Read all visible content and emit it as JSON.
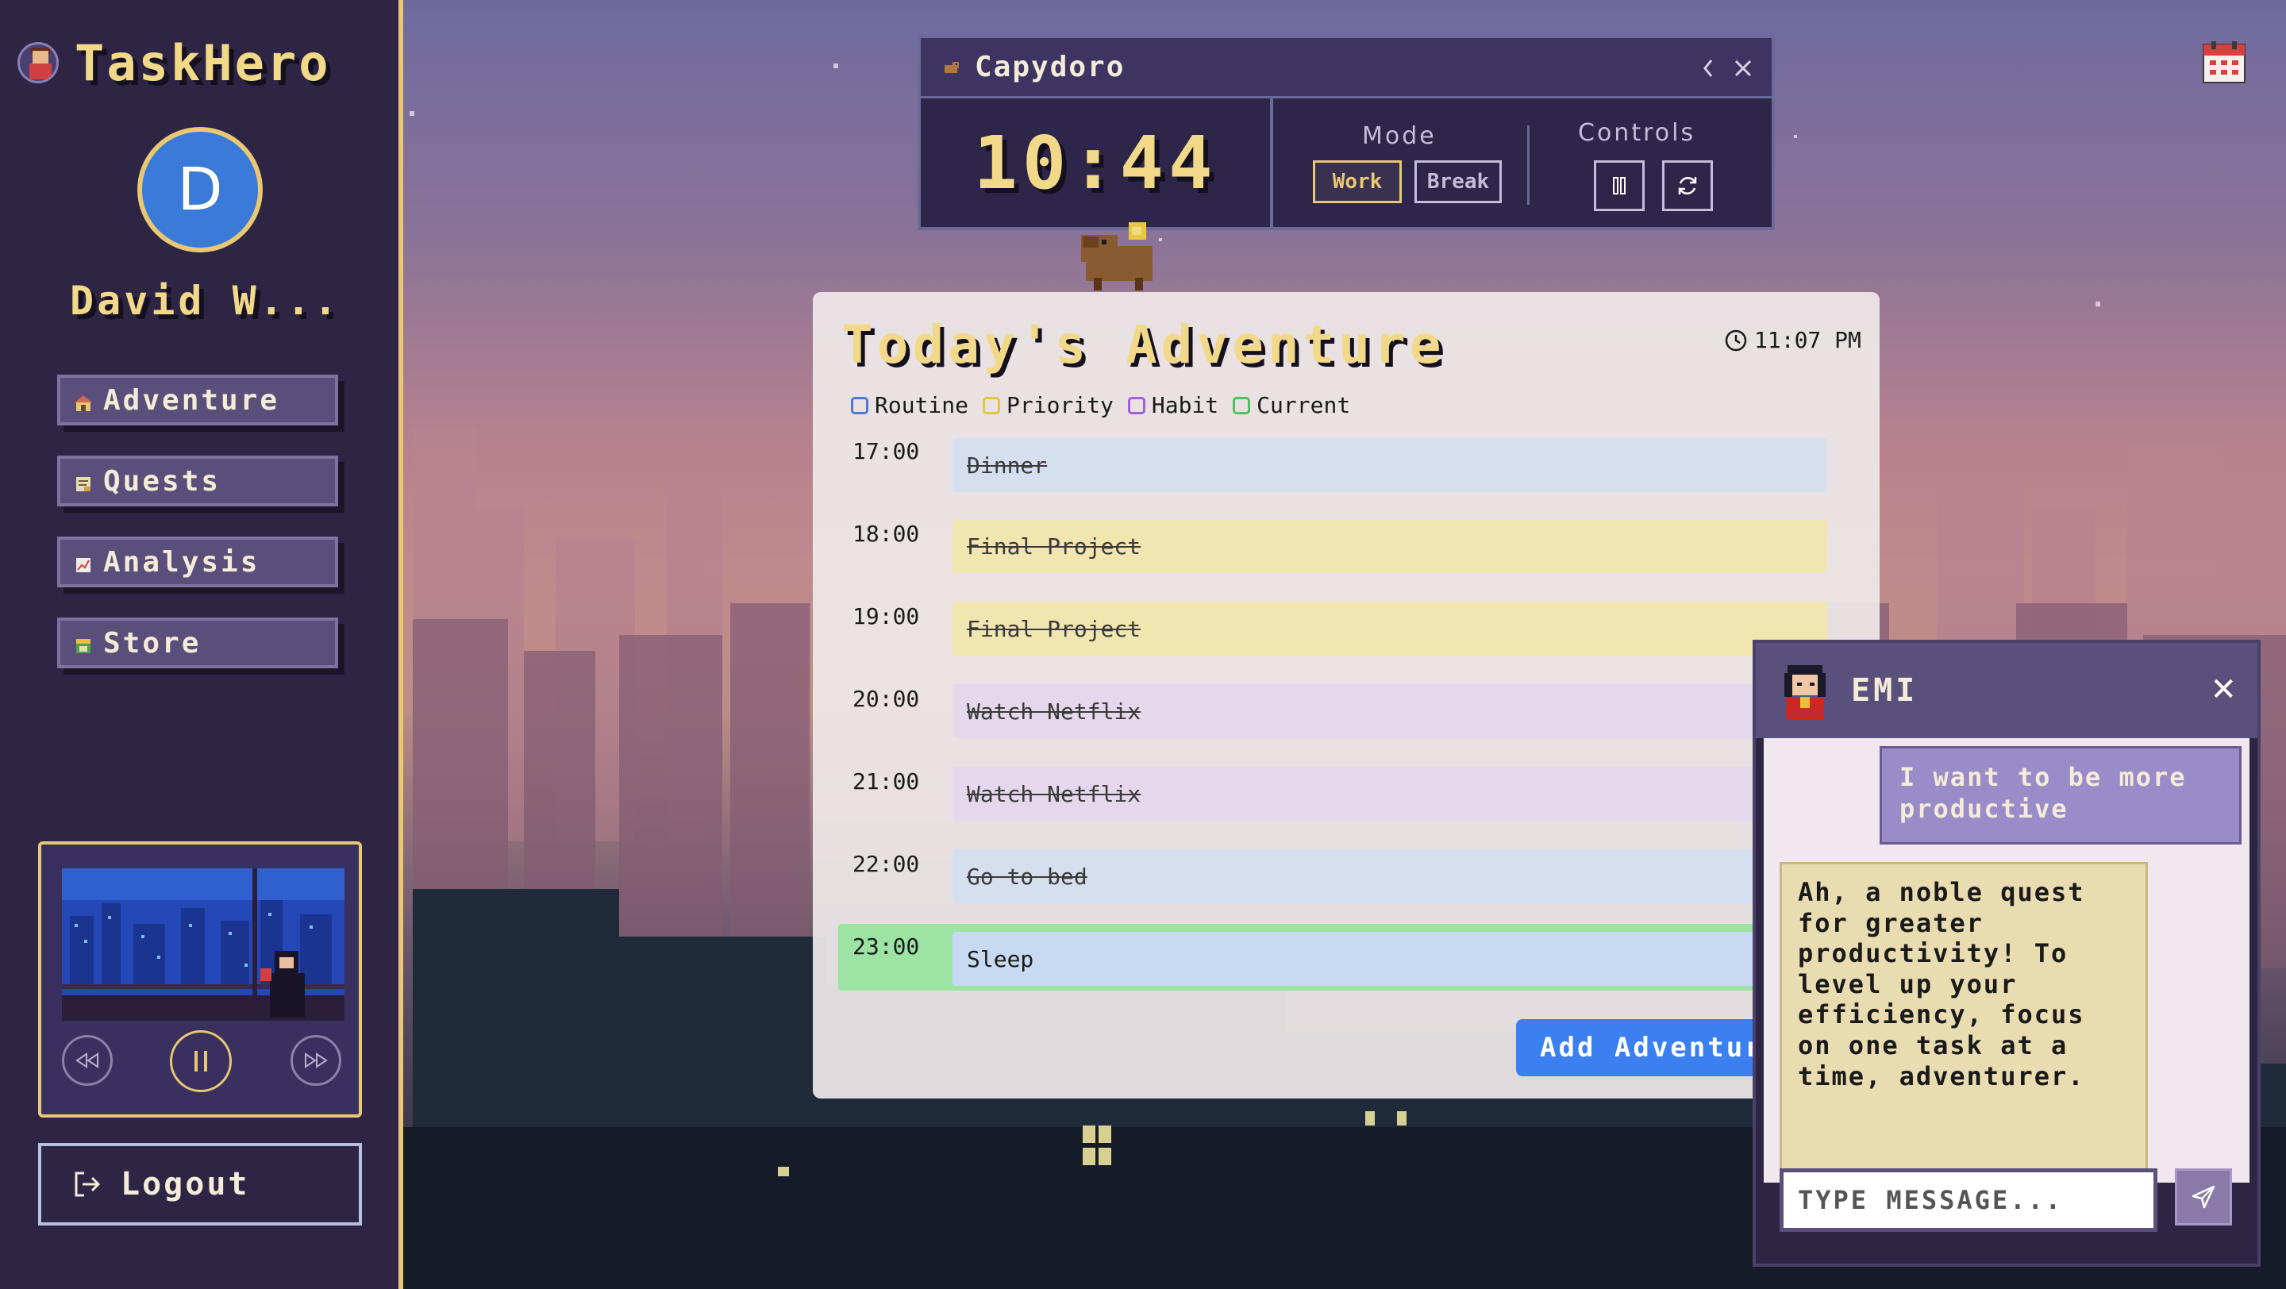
{
  "app": {
    "title": "TaskHero"
  },
  "user": {
    "initial": "D",
    "name": "David W..."
  },
  "nav": {
    "items": [
      {
        "id": "adventure",
        "label": "Adventure",
        "icon": "house-icon"
      },
      {
        "id": "quests",
        "label": "Quests",
        "icon": "scroll-icon"
      },
      {
        "id": "analysis",
        "label": "Analysis",
        "icon": "chart-icon"
      },
      {
        "id": "store",
        "label": "Store",
        "icon": "shop-icon"
      }
    ],
    "logout_label": "Logout"
  },
  "music_player": {
    "state": "playing",
    "controls": [
      "rewind-icon",
      "pause-icon",
      "fast-forward-icon"
    ]
  },
  "timer": {
    "title": "Capydoro",
    "time": "10:44",
    "mode_label": "Mode",
    "modes": [
      "Work",
      "Break"
    ],
    "active_mode": "Work",
    "controls_label": "Controls"
  },
  "adventure": {
    "title": "Today's Adventure",
    "current_time": "11:07 PM",
    "legend": [
      {
        "label": "Routine",
        "color": "#4a7ad8"
      },
      {
        "label": "Priority",
        "color": "#e0c840"
      },
      {
        "label": "Habit",
        "color": "#a060d8"
      },
      {
        "label": "Current",
        "color": "#50c060"
      }
    ],
    "schedule": [
      {
        "time": "17:00",
        "task": "Dinner",
        "type": "routine",
        "done": true
      },
      {
        "time": "18:00",
        "task": "Final Project",
        "type": "priority",
        "done": true
      },
      {
        "time": "19:00",
        "task": "Final Project",
        "type": "priority",
        "done": true
      },
      {
        "time": "20:00",
        "task": "Watch Netflix",
        "type": "habit",
        "done": true
      },
      {
        "time": "21:00",
        "task": "Watch Netflix",
        "type": "habit",
        "done": true
      },
      {
        "time": "22:00",
        "task": "Go to bed",
        "type": "routine",
        "done": true
      },
      {
        "time": "23:00",
        "task": "Sleep",
        "type": "routine",
        "done": false,
        "current": true
      }
    ],
    "add_button": "Add Adventure"
  },
  "chat": {
    "name": "EMI",
    "messages": [
      {
        "from": "user",
        "text": "I want to be more productive"
      },
      {
        "from": "bot",
        "text": "Ah, a noble quest for greater productivity! To level up your efficiency, focus on one task at a time, adventurer."
      }
    ],
    "input_placeholder": "TYPE MESSAGE..."
  },
  "colors": {
    "accent_gold": "#e8c873",
    "sidebar_bg": "#2e2544",
    "primary_blue": "#3b7ff0",
    "current_green": "#9ce3a4"
  }
}
